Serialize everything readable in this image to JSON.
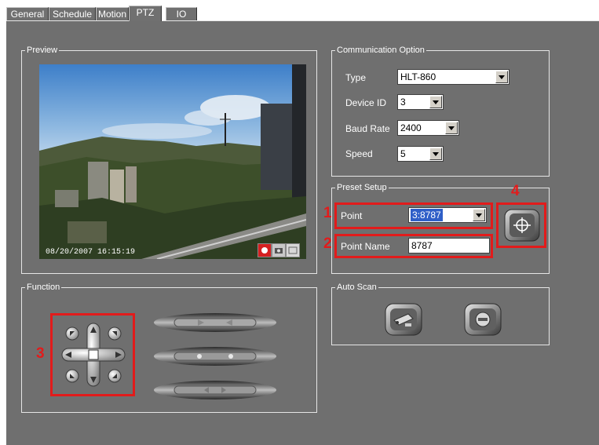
{
  "tabs": [
    {
      "label": "General"
    },
    {
      "label": "Schedule"
    },
    {
      "label": "Motion"
    },
    {
      "label": "PTZ"
    },
    {
      "label": "IO"
    }
  ],
  "active_tab": "PTZ",
  "preview": {
    "title": "Preview",
    "timestamp": "08/20/2007 16:15:19"
  },
  "communication": {
    "title": "Communication Option",
    "type_label": "Type",
    "type_value": "HLT-860",
    "device_id_label": "Device ID",
    "device_id_value": "3",
    "baud_rate_label": "Baud Rate",
    "baud_rate_value": "2400",
    "speed_label": "Speed",
    "speed_value": "5"
  },
  "preset": {
    "title": "Preset Setup",
    "point_label": "Point",
    "point_value": "3:8787",
    "point_name_label": "Point Name",
    "point_name_value": "8787"
  },
  "function": {
    "title": "Function"
  },
  "auto_scan": {
    "title": "Auto Scan"
  },
  "callouts": [
    "1",
    "2",
    "3",
    "4"
  ],
  "colors": {
    "callout": "#e21b1b",
    "panel": "#6f6f6f",
    "selection": "#2f5fc8"
  }
}
